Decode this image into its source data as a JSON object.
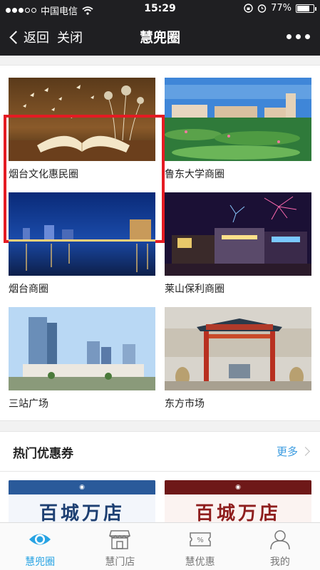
{
  "status_bar": {
    "carrier": "中国电信",
    "time": "15:29",
    "battery_percent": "77%",
    "battery_level": 0.77
  },
  "nav": {
    "back_label": "返回",
    "close_label": "关闭",
    "title": "慧兜圈"
  },
  "circles": [
    {
      "label": "烟台文化惠民圈",
      "image": "open-book-with-butterflies",
      "selected": true
    },
    {
      "label": "鲁东大学商圈",
      "image": "campus-lotus-pond"
    },
    {
      "label": "烟台商圈",
      "image": "city-waterfront-at-night"
    },
    {
      "label": "莱山保利商圈",
      "image": "mall-with-fireworks"
    },
    {
      "label": "三站广场",
      "image": "modern-office-towers"
    },
    {
      "label": "东方市场",
      "image": "traditional-market-gate"
    }
  ],
  "coupons": {
    "title": "热门优惠券",
    "more_label": "更多",
    "items": [
      {
        "banner_text": "百城万店",
        "theme_color": "#1d3f72"
      },
      {
        "banner_text": "百城万店",
        "theme_color": "#8e1d1d"
      }
    ]
  },
  "tabbar": {
    "items": [
      {
        "label": "慧兜圈",
        "icon": "eye-icon",
        "active": true
      },
      {
        "label": "慧门店",
        "icon": "storefront-icon"
      },
      {
        "label": "慧优惠",
        "icon": "coupon-percent-icon"
      },
      {
        "label": "我的",
        "icon": "user-icon"
      }
    ]
  },
  "colors": {
    "accent": "#27a3e3",
    "highlight": "#e51b23",
    "header_bg": "#1f1f22"
  }
}
